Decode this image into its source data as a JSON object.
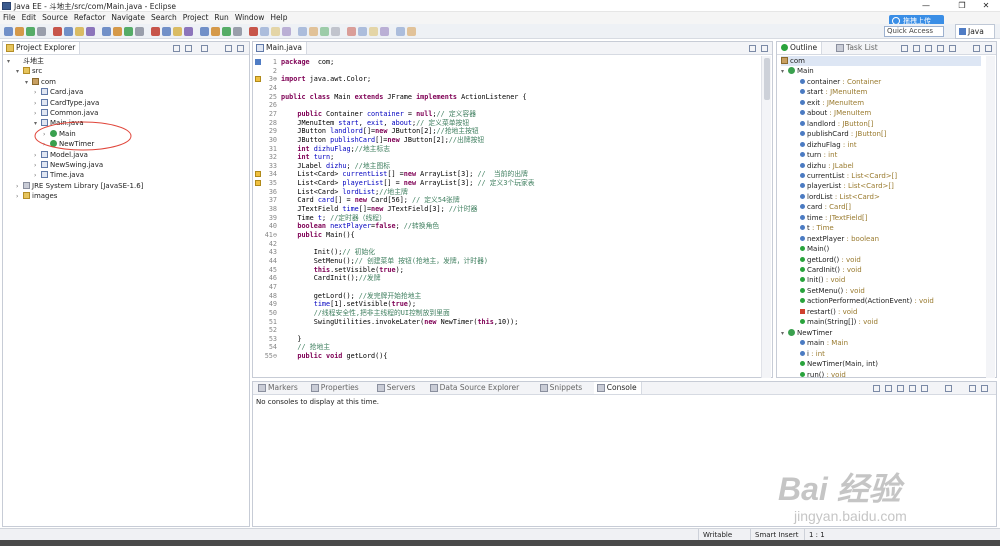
{
  "window": {
    "title": "Java EE - 斗地主/src/com/Main.java - Eclipse"
  },
  "menu": [
    "File",
    "Edit",
    "Source",
    "Refactor",
    "Navigate",
    "Search",
    "Project",
    "Run",
    "Window",
    "Help"
  ],
  "popup": {
    "label": "拖拽上传"
  },
  "quick_access": {
    "placeholder": "Quick Access"
  },
  "perspective": {
    "label": "Java EE"
  },
  "explorer": {
    "tab": "Project Explorer",
    "items": [
      {
        "label": "斗地主",
        "kind": "project",
        "depth": 0,
        "exp": "▾"
      },
      {
        "label": "src",
        "kind": "folder",
        "depth": 1,
        "exp": "▾"
      },
      {
        "label": "com",
        "kind": "pkg",
        "depth": 2,
        "exp": "▾"
      },
      {
        "label": "Card.java",
        "kind": "java",
        "depth": 3,
        "exp": "›"
      },
      {
        "label": "CardType.java",
        "kind": "java",
        "depth": 3,
        "exp": "›"
      },
      {
        "label": "Common.java",
        "kind": "java",
        "depth": 3,
        "exp": "›"
      },
      {
        "label": "Main.java",
        "kind": "java",
        "depth": 3,
        "exp": "▾"
      },
      {
        "label": "Main",
        "kind": "cls",
        "depth": 4,
        "exp": "›"
      },
      {
        "label": "NewTimer",
        "kind": "cls",
        "depth": 4,
        "exp": "›"
      },
      {
        "label": "Model.java",
        "kind": "java",
        "depth": 3,
        "exp": "›"
      },
      {
        "label": "NewSwing.java",
        "kind": "java",
        "depth": 3,
        "exp": "›"
      },
      {
        "label": "Time.java",
        "kind": "java",
        "depth": 3,
        "exp": "›"
      },
      {
        "label": "JRE System Library [JavaSE-1.6]",
        "kind": "lib",
        "depth": 1,
        "exp": "›"
      },
      {
        "label": "images",
        "kind": "folder",
        "depth": 1,
        "exp": "›"
      }
    ]
  },
  "editor": {
    "tab": "Main.java",
    "lines": [
      {
        "n": "1",
        "segs": [
          [
            "kw",
            "package"
          ],
          [
            "",
            "  com;"
          ]
        ],
        "mark": "bp"
      },
      {
        "n": "2",
        "segs": []
      },
      {
        "n": "3⊕",
        "segs": [
          [
            "kw",
            "import"
          ],
          [
            "",
            " java.awt.Color;"
          ]
        ],
        "mark": "warn"
      },
      {
        "n": "24",
        "segs": []
      },
      {
        "n": "25",
        "segs": [
          [
            "kw",
            "public class"
          ],
          [
            "",
            " Main "
          ],
          [
            "kw",
            "extends"
          ],
          [
            "",
            " JFrame "
          ],
          [
            "kw",
            "implements"
          ],
          [
            "",
            " ActionListener {"
          ]
        ]
      },
      {
        "n": "26",
        "segs": []
      },
      {
        "n": "27",
        "segs": [
          [
            "",
            "    "
          ],
          [
            "kw",
            "public"
          ],
          [
            "",
            " Container "
          ],
          [
            "fd",
            "container"
          ],
          [
            "",
            " = "
          ],
          [
            "kw",
            "null"
          ],
          [
            "",
            ";"
          ],
          [
            "cm",
            "// 定义容器"
          ]
        ]
      },
      {
        "n": "28",
        "segs": [
          [
            "",
            "    JMenuItem "
          ],
          [
            "fd",
            "start"
          ],
          [
            "",
            ", "
          ],
          [
            "fd",
            "exit"
          ],
          [
            "",
            ", "
          ],
          [
            "fd",
            "about"
          ],
          [
            "",
            ";"
          ],
          [
            "cm",
            "// 定义菜单按钮"
          ]
        ]
      },
      {
        "n": "29",
        "segs": [
          [
            "",
            "    JButton "
          ],
          [
            "fd",
            "landlord"
          ],
          [
            "",
            "[]="
          ],
          [
            "kw",
            "new"
          ],
          [
            "",
            " JButton[2];"
          ],
          [
            "cm",
            "//抢地主按钮"
          ]
        ]
      },
      {
        "n": "30",
        "segs": [
          [
            "",
            "    JButton "
          ],
          [
            "fd",
            "publishCard"
          ],
          [
            "",
            "[]="
          ],
          [
            "kw",
            "new"
          ],
          [
            "",
            " JButton[2];"
          ],
          [
            "cm",
            "//出牌按钮"
          ]
        ]
      },
      {
        "n": "31",
        "segs": [
          [
            "",
            "    "
          ],
          [
            "kw",
            "int"
          ],
          [
            "",
            " "
          ],
          [
            "fd",
            "dizhuFlag"
          ],
          [
            "",
            ";"
          ],
          [
            "cm",
            "//地主标志"
          ]
        ]
      },
      {
        "n": "32",
        "segs": [
          [
            "",
            "    "
          ],
          [
            "kw",
            "int"
          ],
          [
            "",
            " "
          ],
          [
            "fd",
            "turn"
          ],
          [
            "",
            ";"
          ]
        ]
      },
      {
        "n": "33",
        "segs": [
          [
            "",
            "    JLabel "
          ],
          [
            "fd",
            "dizhu"
          ],
          [
            "",
            "; "
          ],
          [
            "cm",
            "//地主图标"
          ]
        ]
      },
      {
        "n": "34",
        "segs": [
          [
            "",
            "    List<Card> "
          ],
          [
            "fd",
            "currentList"
          ],
          [
            "",
            "[] ="
          ],
          [
            "kw",
            "new"
          ],
          [
            "",
            " ArrayList[3]; "
          ],
          [
            "cm",
            "//  当前的出牌"
          ]
        ],
        "mark": "warn"
      },
      {
        "n": "35",
        "segs": [
          [
            "",
            "    List<Card> "
          ],
          [
            "fd",
            "playerList"
          ],
          [
            "",
            "[] = "
          ],
          [
            "kw",
            "new"
          ],
          [
            "",
            " ArrayList[3]; "
          ],
          [
            "cm",
            "// 定义3个玩家表"
          ]
        ],
        "mark": "warn"
      },
      {
        "n": "36",
        "segs": [
          [
            "",
            "    List<Card> "
          ],
          [
            "fd",
            "lordList"
          ],
          [
            "",
            ";"
          ],
          [
            "cm",
            "//地主牌"
          ]
        ]
      },
      {
        "n": "37",
        "segs": [
          [
            "",
            "    Card "
          ],
          [
            "fd",
            "card"
          ],
          [
            "",
            "[] = "
          ],
          [
            "kw",
            "new"
          ],
          [
            "",
            " Card[56]; "
          ],
          [
            "cm",
            "// 定义54张牌"
          ]
        ]
      },
      {
        "n": "38",
        "segs": [
          [
            "",
            "    JTextField "
          ],
          [
            "fd",
            "time"
          ],
          [
            "",
            "[]="
          ],
          [
            "kw",
            "new"
          ],
          [
            "",
            " JTextField[3]; "
          ],
          [
            "cm",
            "//计时器"
          ]
        ]
      },
      {
        "n": "39",
        "segs": [
          [
            "",
            "    Time "
          ],
          [
            "fd",
            "t"
          ],
          [
            "",
            "; "
          ],
          [
            "cm",
            "//定时器（线程）"
          ]
        ]
      },
      {
        "n": "40",
        "segs": [
          [
            "",
            "    "
          ],
          [
            "kw",
            "boolean"
          ],
          [
            "",
            " "
          ],
          [
            "fd",
            "nextPlayer"
          ],
          [
            "",
            "="
          ],
          [
            "kw",
            "false"
          ],
          [
            "",
            "; "
          ],
          [
            "cm",
            "//转换角色"
          ]
        ]
      },
      {
        "n": "41⊖",
        "segs": [
          [
            "",
            "    "
          ],
          [
            "kw",
            "public"
          ],
          [
            "",
            " Main(){"
          ]
        ]
      },
      {
        "n": "42",
        "segs": []
      },
      {
        "n": "43",
        "segs": [
          [
            "",
            "        Init();"
          ],
          [
            "cm",
            "// 初始化"
          ]
        ]
      },
      {
        "n": "44",
        "segs": [
          [
            "",
            "        SetMenu();"
          ],
          [
            "cm",
            "// 创建菜单 按钮(抢地主，发牌，计时器)"
          ]
        ]
      },
      {
        "n": "45",
        "segs": [
          [
            "",
            "        "
          ],
          [
            "kw",
            "this"
          ],
          [
            "",
            ".setVisible("
          ],
          [
            "kw",
            "true"
          ],
          [
            "",
            ");"
          ]
        ]
      },
      {
        "n": "46",
        "segs": [
          [
            "",
            "        CardInit();"
          ],
          [
            "cm",
            "//发牌"
          ]
        ]
      },
      {
        "n": "47",
        "segs": []
      },
      {
        "n": "48",
        "segs": [
          [
            "",
            "        getLord(); "
          ],
          [
            "cm",
            "//发完牌开始抢地主"
          ]
        ]
      },
      {
        "n": "49",
        "segs": [
          [
            "",
            "        "
          ],
          [
            "fd",
            "time"
          ],
          [
            "",
            "[1].setVisible("
          ],
          [
            "kw",
            "true"
          ],
          [
            "",
            ");"
          ]
        ]
      },
      {
        "n": "50",
        "segs": [
          [
            "",
            "        "
          ],
          [
            "cm",
            "//线程安全性,把非主线程的UI控制放到里面"
          ]
        ]
      },
      {
        "n": "51",
        "segs": [
          [
            "",
            "        SwingUtilities."
          ],
          [
            "",
            "invokeLater("
          ],
          [
            "kw",
            "new"
          ],
          [
            "",
            " NewTimer("
          ],
          [
            "kw",
            "this"
          ],
          [
            "",
            ",10));"
          ]
        ]
      },
      {
        "n": "52",
        "segs": []
      },
      {
        "n": "53",
        "segs": [
          [
            "",
            "    }"
          ]
        ]
      },
      {
        "n": "54",
        "segs": [
          [
            "",
            "    "
          ],
          [
            "cm",
            "// 抢地主"
          ]
        ]
      },
      {
        "n": "55⊖",
        "segs": [
          [
            "",
            "    "
          ],
          [
            "kw",
            "public void"
          ],
          [
            "",
            " getLord(){"
          ]
        ]
      }
    ]
  },
  "outline": {
    "tabs": [
      "Outline",
      "Task List"
    ],
    "items": [
      {
        "name": "com",
        "type": "",
        "kind": "pkg",
        "depth": 0
      },
      {
        "name": "Main",
        "type": "",
        "kind": "cls",
        "depth": 0,
        "exp": "▾"
      },
      {
        "name": "container",
        "type": " : Container",
        "kind": "field",
        "depth": 2
      },
      {
        "name": "start",
        "type": " : JMenuItem",
        "kind": "field",
        "depth": 2
      },
      {
        "name": "exit",
        "type": " : JMenuItem",
        "kind": "field",
        "depth": 2
      },
      {
        "name": "about",
        "type": " : JMenuItem",
        "kind": "field",
        "depth": 2
      },
      {
        "name": "landlord",
        "type": " : JButton[]",
        "kind": "field",
        "depth": 2
      },
      {
        "name": "publishCard",
        "type": " : JButton[]",
        "kind": "field",
        "depth": 2
      },
      {
        "name": "dizhuFlag",
        "type": " : int",
        "kind": "field",
        "depth": 2
      },
      {
        "name": "turn",
        "type": " : int",
        "kind": "field",
        "depth": 2
      },
      {
        "name": "dizhu",
        "type": " : JLabel",
        "kind": "field",
        "depth": 2
      },
      {
        "name": "currentList",
        "type": " : List<Card>[]",
        "kind": "field",
        "depth": 2
      },
      {
        "name": "playerList",
        "type": " : List<Card>[]",
        "kind": "field",
        "depth": 2
      },
      {
        "name": "lordList",
        "type": " : List<Card>",
        "kind": "field",
        "depth": 2
      },
      {
        "name": "card",
        "type": " : Card[]",
        "kind": "field",
        "depth": 2
      },
      {
        "name": "time",
        "type": " : JTextField[]",
        "kind": "field",
        "depth": 2
      },
      {
        "name": "t",
        "type": " : Time",
        "kind": "field",
        "depth": 2
      },
      {
        "name": "nextPlayer",
        "type": " : boolean",
        "kind": "field",
        "depth": 2
      },
      {
        "name": "Main()",
        "type": "",
        "kind": "meth",
        "depth": 2
      },
      {
        "name": "getLord()",
        "type": " : void",
        "kind": "meth",
        "depth": 2
      },
      {
        "name": "CardInit()",
        "type": " : void",
        "kind": "meth",
        "depth": 2
      },
      {
        "name": "Init()",
        "type": " : void",
        "kind": "meth",
        "depth": 2
      },
      {
        "name": "SetMenu()",
        "type": " : void",
        "kind": "meth",
        "depth": 2
      },
      {
        "name": "actionPerformed(ActionEvent)",
        "type": " : void",
        "kind": "meth",
        "depth": 2
      },
      {
        "name": "restart()",
        "type": " : void",
        "kind": "red",
        "depth": 2
      },
      {
        "name": "main(String[])",
        "type": " : void",
        "kind": "meth",
        "depth": 2
      },
      {
        "name": "NewTimer",
        "type": "",
        "kind": "cls",
        "depth": 0,
        "exp": "▾"
      },
      {
        "name": "main",
        "type": " : Main",
        "kind": "field",
        "depth": 2
      },
      {
        "name": "i",
        "type": " : int",
        "kind": "field",
        "depth": 2
      },
      {
        "name": "NewTimer(Main, int)",
        "type": "",
        "kind": "meth",
        "depth": 2
      },
      {
        "name": "run()",
        "type": " : void",
        "kind": "meth",
        "depth": 2
      }
    ]
  },
  "console": {
    "tabs": [
      "Markers",
      "Properties",
      "Servers",
      "Data Source Explorer",
      "Snippets",
      "Console"
    ],
    "message": "No consoles to display at this time."
  },
  "status": {
    "writable": "Writable",
    "insert": "Smart Insert",
    "position": "1 : 1"
  },
  "watermark": {
    "brand": "Bai 经验",
    "url": "jingyan.baidu.com"
  },
  "colors": {
    "accent": "#3a8ee6",
    "keyword": "#7f0055",
    "comment": "#3f7f5f",
    "field": "#0000c0"
  }
}
